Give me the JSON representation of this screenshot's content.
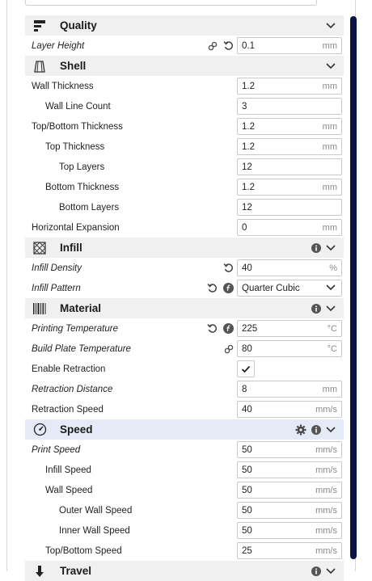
{
  "categories": {
    "quality": {
      "title": "Quality",
      "icon": "quality-icon"
    },
    "shell": {
      "title": "Shell",
      "icon": "shell-icon"
    },
    "infill": {
      "title": "Infill",
      "icon": "infill-icon"
    },
    "material": {
      "title": "Material",
      "icon": "material-icon"
    },
    "speed": {
      "title": "Speed",
      "icon": "speed-icon"
    },
    "travel": {
      "title": "Travel",
      "icon": "travel-icon"
    }
  },
  "settings": {
    "layer_height": {
      "label": "Layer Height",
      "value": "0.1",
      "unit": "mm"
    },
    "wall_thickness": {
      "label": "Wall Thickness",
      "value": "1.2",
      "unit": "mm"
    },
    "wall_line_count": {
      "label": "Wall Line Count",
      "value": "3"
    },
    "top_bottom_thickness": {
      "label": "Top/Bottom Thickness",
      "value": "1.2",
      "unit": "mm"
    },
    "top_thickness": {
      "label": "Top Thickness",
      "value": "1.2",
      "unit": "mm"
    },
    "top_layers": {
      "label": "Top Layers",
      "value": "12"
    },
    "bottom_thickness": {
      "label": "Bottom Thickness",
      "value": "1.2",
      "unit": "mm"
    },
    "bottom_layers": {
      "label": "Bottom Layers",
      "value": "12"
    },
    "horizontal_expansion": {
      "label": "Horizontal Expansion",
      "value": "0",
      "unit": "mm"
    },
    "infill_density": {
      "label": "Infill Density",
      "value": "40",
      "unit": "%"
    },
    "infill_pattern": {
      "label": "Infill Pattern",
      "value": "Quarter Cubic"
    },
    "printing_temperature": {
      "label": "Printing Temperature",
      "value": "225",
      "unit": "°C"
    },
    "build_plate_temperature": {
      "label": "Build Plate Temperature",
      "value": "80",
      "unit": "°C"
    },
    "enable_retraction": {
      "label": "Enable Retraction",
      "checked": true
    },
    "retraction_distance": {
      "label": "Retraction Distance",
      "value": "8",
      "unit": "mm"
    },
    "retraction_speed": {
      "label": "Retraction Speed",
      "value": "40",
      "unit": "mm/s"
    },
    "print_speed": {
      "label": "Print Speed",
      "value": "50",
      "unit": "mm/s"
    },
    "infill_speed": {
      "label": "Infill Speed",
      "value": "50",
      "unit": "mm/s"
    },
    "wall_speed": {
      "label": "Wall Speed",
      "value": "50",
      "unit": "mm/s"
    },
    "outer_wall_speed": {
      "label": "Outer Wall Speed",
      "value": "50",
      "unit": "mm/s"
    },
    "inner_wall_speed": {
      "label": "Inner Wall Speed",
      "value": "50",
      "unit": "mm/s"
    },
    "top_bottom_speed": {
      "label": "Top/Bottom Speed",
      "value": "25",
      "unit": "mm/s"
    }
  },
  "colors": {
    "scrollbar": "#0b1447",
    "category_bg": "#f0f0f0",
    "active_category_bg": "#e4ebf6"
  }
}
